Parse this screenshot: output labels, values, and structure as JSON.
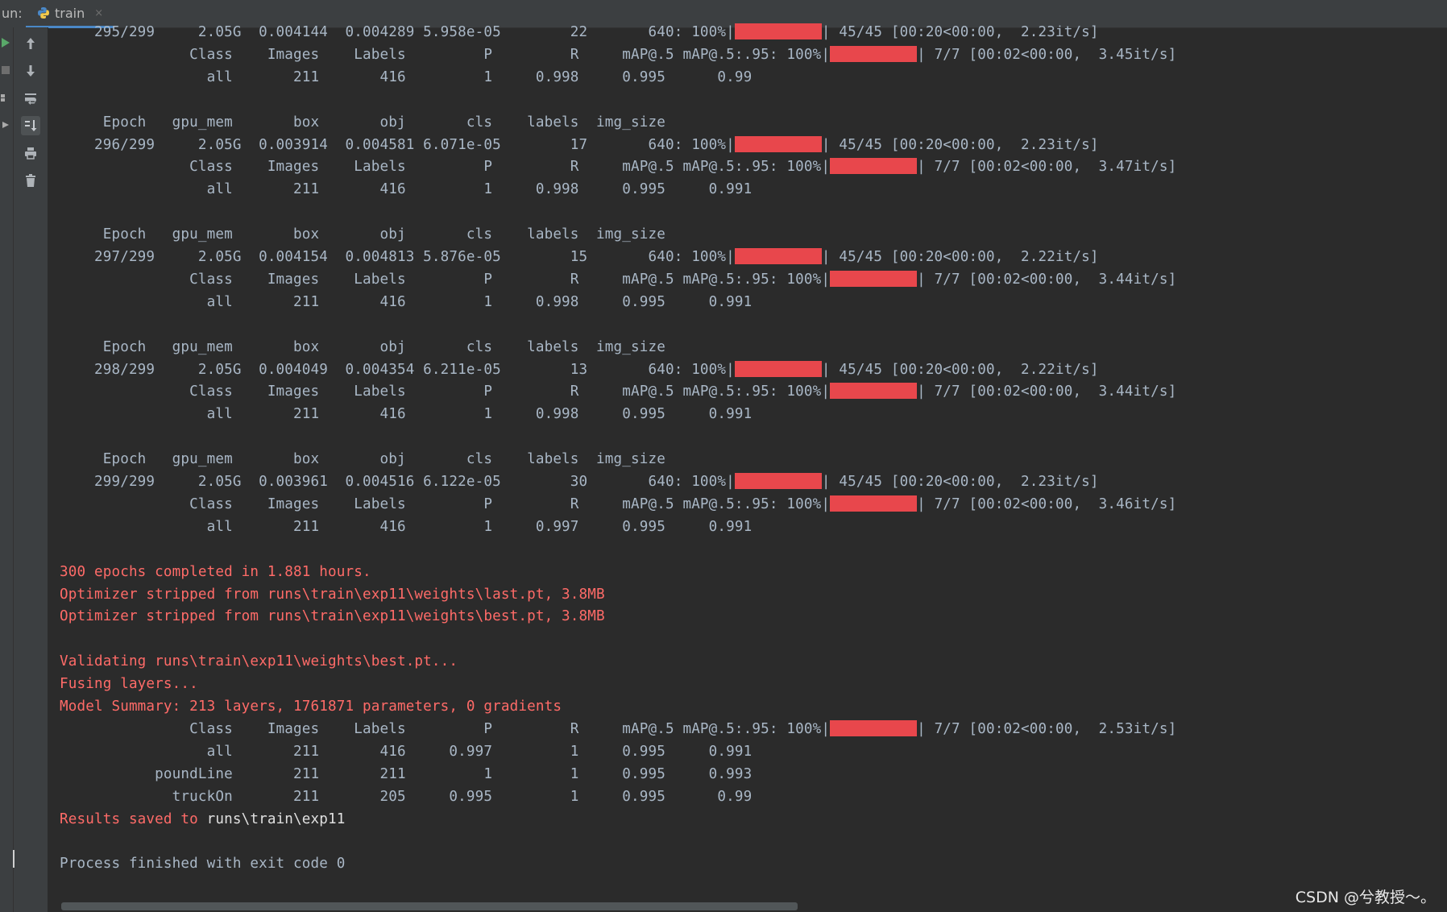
{
  "window": {
    "run_label": "un:",
    "tab_label": "train",
    "tab_close": "×"
  },
  "toolbar_icons": [
    "up-arrow-icon",
    "down-arrow-icon",
    "soft-wrap-icon",
    "scroll-to-end-icon",
    "print-icon",
    "trash-icon"
  ],
  "console_lines": [
    {
      "text": "    295/299     2.05G  0.004144  0.004289 5.958e-05        22       640: 100%|",
      "bar": 108,
      "after": "| 45/45 [00:20<00:00,  2.23it/s]"
    },
    {
      "text": "               Class    Images    Labels         P         R     mAP@.5 mAP@.5:.95: 100%|",
      "bar": 108,
      "after": "| 7/7 [00:02<00:00,  3.45it/s]"
    },
    {
      "text": "                 all       211       416         1     0.998     0.995      0.99"
    },
    {
      "text": ""
    },
    {
      "text": "     Epoch   gpu_mem       box       obj       cls    labels  img_size"
    },
    {
      "text": "    296/299     2.05G  0.003914  0.004581 6.071e-05        17       640: 100%|",
      "bar": 108,
      "after": "| 45/45 [00:20<00:00,  2.23it/s]"
    },
    {
      "text": "               Class    Images    Labels         P         R     mAP@.5 mAP@.5:.95: 100%|",
      "bar": 108,
      "after": "| 7/7 [00:02<00:00,  3.47it/s]"
    },
    {
      "text": "                 all       211       416         1     0.998     0.995     0.991"
    },
    {
      "text": ""
    },
    {
      "text": "     Epoch   gpu_mem       box       obj       cls    labels  img_size"
    },
    {
      "text": "    297/299     2.05G  0.004154  0.004813 5.876e-05        15       640: 100%|",
      "bar": 108,
      "after": "| 45/45 [00:20<00:00,  2.22it/s]"
    },
    {
      "text": "               Class    Images    Labels         P         R     mAP@.5 mAP@.5:.95: 100%|",
      "bar": 108,
      "after": "| 7/7 [00:02<00:00,  3.44it/s]"
    },
    {
      "text": "                 all       211       416         1     0.998     0.995     0.991"
    },
    {
      "text": ""
    },
    {
      "text": "     Epoch   gpu_mem       box       obj       cls    labels  img_size"
    },
    {
      "text": "    298/299     2.05G  0.004049  0.004354 6.211e-05        13       640: 100%|",
      "bar": 108,
      "after": "| 45/45 [00:20<00:00,  2.22it/s]"
    },
    {
      "text": "               Class    Images    Labels         P         R     mAP@.5 mAP@.5:.95: 100%|",
      "bar": 108,
      "after": "| 7/7 [00:02<00:00,  3.44it/s]"
    },
    {
      "text": "                 all       211       416         1     0.998     0.995     0.991"
    },
    {
      "text": ""
    },
    {
      "text": "     Epoch   gpu_mem       box       obj       cls    labels  img_size"
    },
    {
      "text": "    299/299     2.05G  0.003961  0.004516 6.122e-05        30       640: 100%|",
      "bar": 108,
      "after": "| 45/45 [00:20<00:00,  2.23it/s]"
    },
    {
      "text": "               Class    Images    Labels         P         R     mAP@.5 mAP@.5:.95: 100%|",
      "bar": 108,
      "after": "| 7/7 [00:02<00:00,  3.46it/s]"
    },
    {
      "text": "                 all       211       416         1     0.997     0.995     0.991"
    },
    {
      "text": ""
    },
    {
      "text": "300 epochs completed in 1.881 hours.",
      "err": true
    },
    {
      "text": "Optimizer stripped from runs\\train\\exp11\\weights\\last.pt, 3.8MB",
      "err": true
    },
    {
      "text": "Optimizer stripped from runs\\train\\exp11\\weights\\best.pt, 3.8MB",
      "err": true
    },
    {
      "text": ""
    },
    {
      "text": "Validating runs\\train\\exp11\\weights\\best.pt...",
      "err": true
    },
    {
      "text": "Fusing layers...",
      "err": true
    },
    {
      "text": "Model Summary: 213 layers, 1761871 parameters, 0 gradients",
      "err": true
    },
    {
      "text": "               Class    Images    Labels         P         R     mAP@.5 mAP@.5:.95: 100%|",
      "bar": 108,
      "after": "| 7/7 [00:02<00:00,  2.53it/s]"
    },
    {
      "text": "                 all       211       416     0.997         1     0.995     0.991"
    },
    {
      "text": "           poundLine       211       211         1         1     0.995     0.993"
    },
    {
      "text": "             truckOn       211       205     0.995         1     0.995      0.99"
    },
    {
      "text": "Results saved to ",
      "err": true,
      "bold": "runs\\train\\exp11"
    },
    {
      "text": ""
    },
    {
      "text": "Process finished with exit code 0"
    }
  ],
  "watermark": "CSDN @兮教授～。",
  "colors": {
    "background": "#2b2b2b",
    "console_text": "#a9b7c6",
    "stderr_text": "#ff6b68",
    "progress_bar": "#e8474c",
    "tab_underline": "#4a88c7"
  }
}
